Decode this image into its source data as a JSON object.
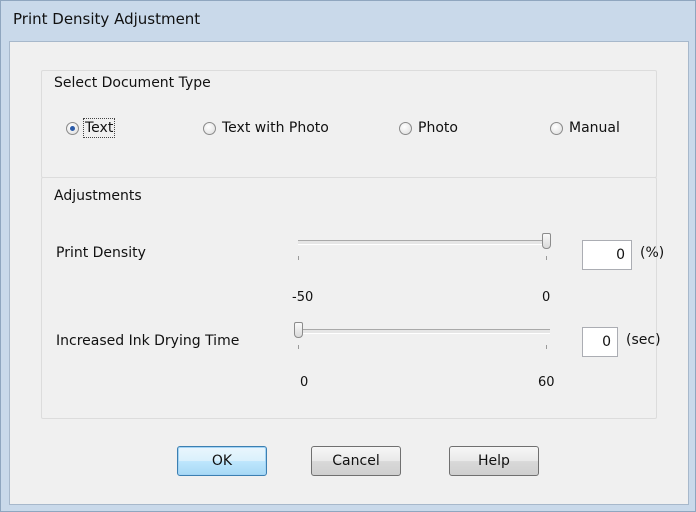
{
  "window": {
    "title": "Print Density Adjustment"
  },
  "document_type": {
    "label": "Select Document Type",
    "selected": "Text",
    "options": [
      "Text",
      "Text with Photo",
      "Photo",
      "Manual"
    ]
  },
  "adjustments": {
    "label": "Adjustments",
    "print_density": {
      "label": "Print Density",
      "min_label": "-50",
      "max_label": "0",
      "value": "0",
      "unit": "(%)",
      "slider_fraction": 1.0
    },
    "drying_time": {
      "label": "Increased Ink Drying Time",
      "min_label": "0",
      "max_label": "60",
      "value": "0",
      "unit": "(sec)",
      "slider_fraction": 0.0
    }
  },
  "buttons": {
    "ok": "OK",
    "cancel": "Cancel",
    "help": "Help"
  }
}
